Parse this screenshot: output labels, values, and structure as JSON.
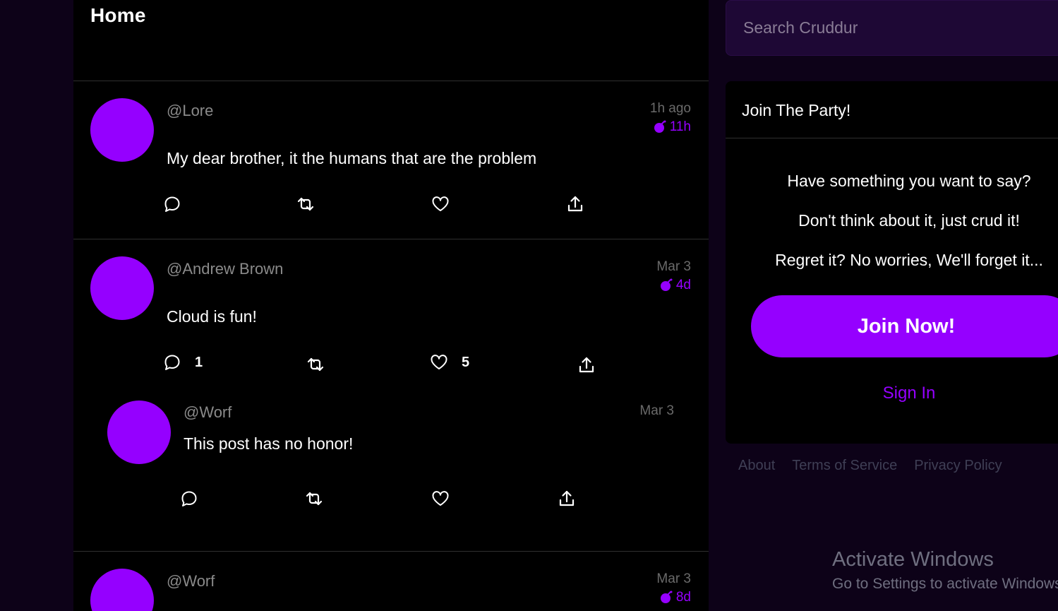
{
  "colors": {
    "accent": "#9500ff",
    "background": "#0d0218",
    "feed_background": "#000000",
    "search_background": "#1e0835"
  },
  "feed": {
    "title": "Home",
    "posts": [
      {
        "handle": "@Lore",
        "message": "My dear brother, it the humans that are the problem",
        "created": "1h ago",
        "expires": "11h",
        "reply_count": "",
        "like_count": ""
      },
      {
        "handle": "@Andrew Brown",
        "message": "Cloud is fun!",
        "created": "Mar 3",
        "expires": "4d",
        "reply_count": "1",
        "like_count": "5",
        "replies": [
          {
            "handle": "@Worf",
            "message": "This post has no honor!",
            "created": "Mar 3"
          }
        ]
      },
      {
        "handle": "@Worf",
        "message": "",
        "created": "Mar 3",
        "expires": "8d"
      }
    ]
  },
  "search": {
    "placeholder": "Search Cruddur"
  },
  "join_card": {
    "title": "Join The Party!",
    "lines": [
      "Have something you want to say?",
      "Don't think about it, just crud it!",
      "Regret it? No worries, We'll forget it..."
    ],
    "join_button": "Join Now!",
    "sign_in": "Sign In"
  },
  "footer": {
    "links": [
      "About",
      "Terms of Service",
      "Privacy Policy"
    ]
  },
  "watermark": {
    "title": "Activate Windows",
    "subtitle": "Go to Settings to activate Windows."
  },
  "icons": {
    "reply": "speech-bubble-icon",
    "repost": "repost-arrows-icon",
    "like": "heart-icon",
    "share": "share-upload-icon",
    "expiry": "bomb-icon"
  }
}
